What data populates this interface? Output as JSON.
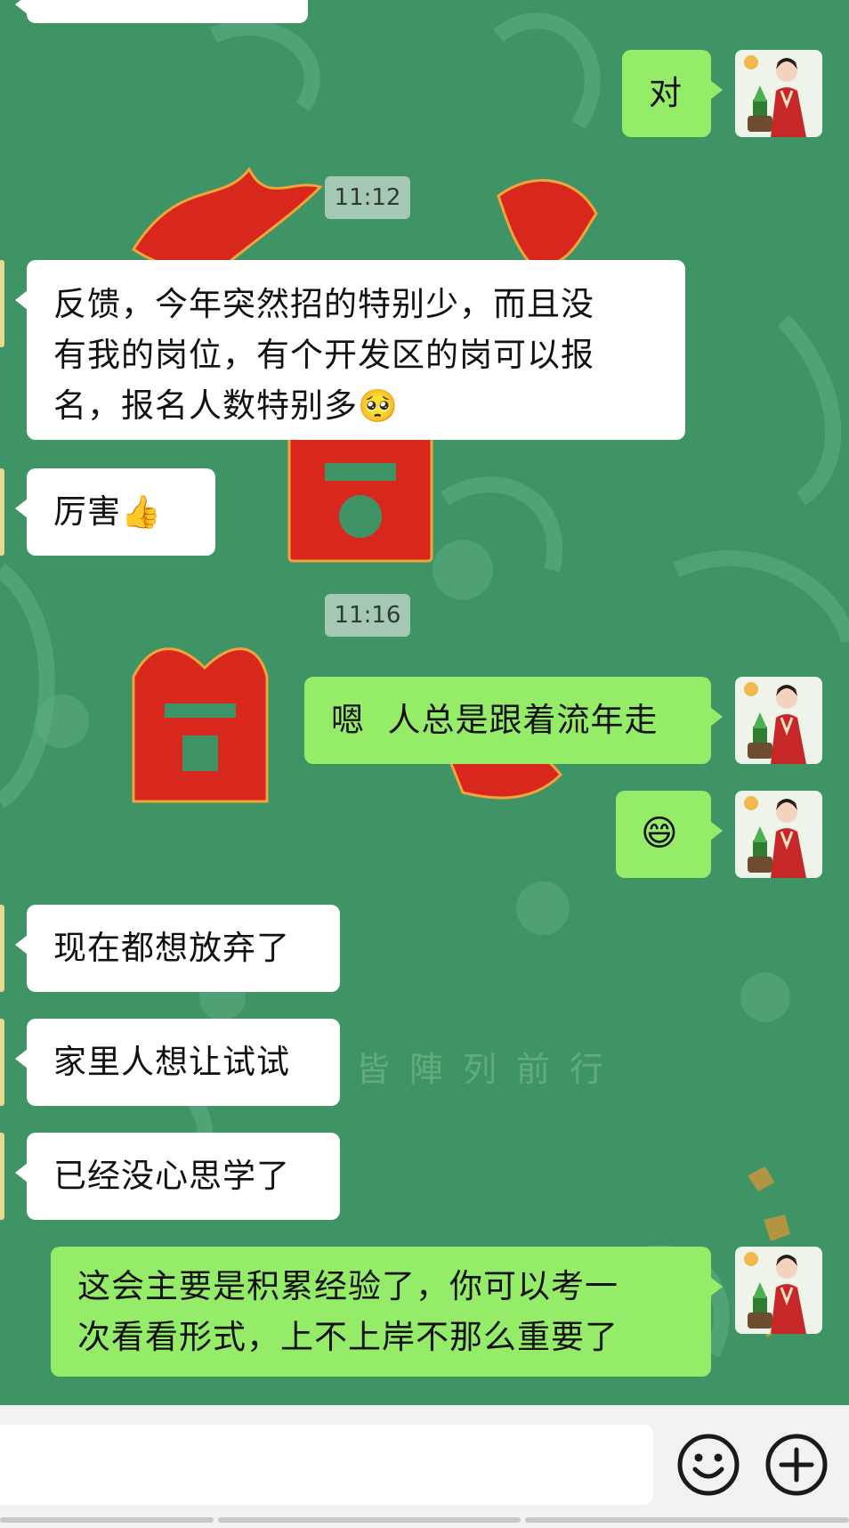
{
  "chat": {
    "timestamps": [
      "11:12",
      "11:16"
    ],
    "messages": [
      {
        "from": "me",
        "text": "对"
      },
      {
        "from": "other",
        "line1": "反馈，今年突然招的特别少，而且没",
        "line2": "有我的岗位，有个开发区的岗可以报",
        "line3": "名，报名人数特别多",
        "emoji": "🥺"
      },
      {
        "from": "other",
        "text": "厉害",
        "emoji": "👍"
      },
      {
        "from": "me",
        "text": "嗯  人总是跟着流年走"
      },
      {
        "from": "me",
        "emoji": "😄"
      },
      {
        "from": "other",
        "text": "现在都想放弃了"
      },
      {
        "from": "other",
        "text": "家里人想让试试"
      },
      {
        "from": "other",
        "text": "已经没心思学了"
      },
      {
        "from": "me",
        "line1": "这会主要是积累经验了，你可以考一",
        "line2": "次看看形式，上不上岸不那么重要了"
      }
    ]
  },
  "wallpaper": {
    "caption": "皆陣列前行"
  },
  "input_bar": {
    "placeholder": ""
  },
  "icons": {
    "emoji_button": "smiley-face-icon",
    "more_button": "plus-circle-icon"
  },
  "colors": {
    "background": "#3f9466",
    "incoming_bubble": "#ffffff",
    "outgoing_bubble": "#95ec69",
    "decoration_red": "#d8281d"
  }
}
